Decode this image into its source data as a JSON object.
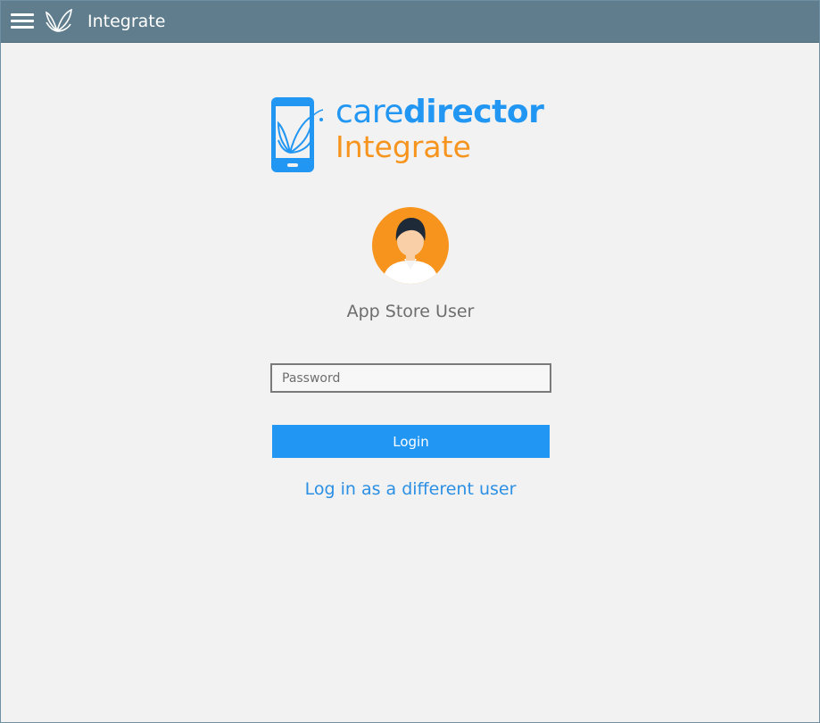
{
  "app": {
    "title": "Integrate"
  },
  "titlebar": {
    "menu_icon": "hamburger-menu-icon",
    "logo_icon": "butterfly-icon"
  },
  "logo": {
    "brand_part1": "care",
    "brand_part2": "director",
    "product": "Integrate",
    "icon": "phone-butterfly-icon"
  },
  "user": {
    "name": "App Store User",
    "avatar_icon": "user-avatar-icon"
  },
  "login_form": {
    "password_placeholder": "Password",
    "login_label": "Login",
    "different_user_label": "Log in as a different user"
  },
  "colors": {
    "titlebar": "#5f7d8c",
    "accent_blue": "#2196f3",
    "accent_orange": "#f7941d",
    "background": "#f2f2f2"
  }
}
